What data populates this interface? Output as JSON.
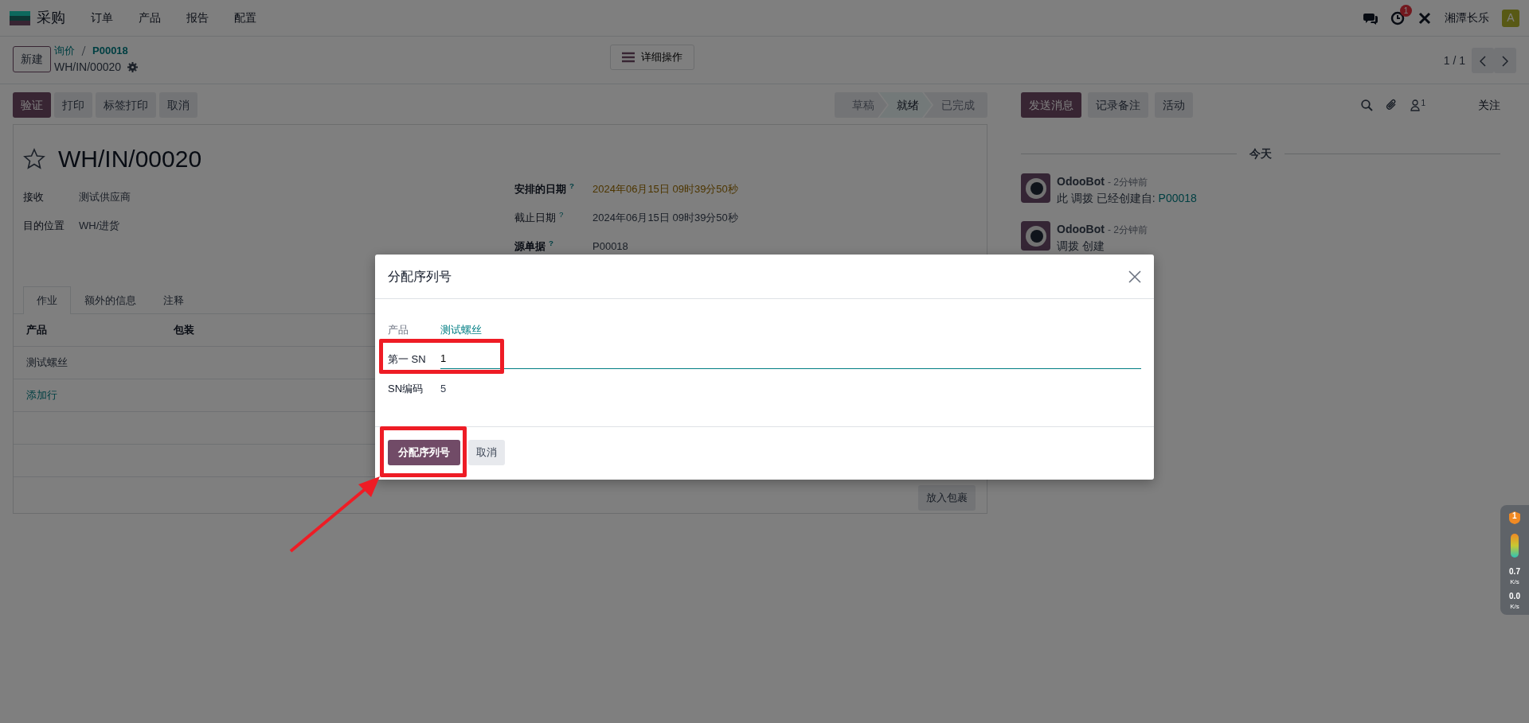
{
  "navbar": {
    "app": "采购",
    "menus": [
      "订单",
      "产品",
      "报告",
      "配置"
    ],
    "activity_count": "1",
    "company": "湘潭长乐",
    "avatar": "A"
  },
  "control_panel": {
    "new_button": "新建",
    "breadcrumbs": [
      "询价",
      "P00018"
    ],
    "record": "WH/IN/00020",
    "actions_button": "详细操作",
    "pager": "1 / 1"
  },
  "buttons": [
    {
      "label": "验证",
      "kind": "primary"
    },
    {
      "label": "打印",
      "kind": "secondary"
    },
    {
      "label": "标签打印",
      "kind": "secondary"
    },
    {
      "label": "取消",
      "kind": "secondary"
    }
  ],
  "status_steps": [
    {
      "label": "草稿",
      "selected": false
    },
    {
      "label": "就绪",
      "selected": true
    },
    {
      "label": "已完成",
      "selected": false
    }
  ],
  "sheet": {
    "starred": false,
    "title": "WH/IN/00020",
    "left_fields": [
      {
        "label": "接收",
        "value": "测试供应商"
      },
      {
        "label": "目的位置",
        "value": "WH/进货"
      }
    ],
    "right_fields": [
      {
        "label": "安排的日期",
        "help": "?",
        "value": "2024年06月15日 09时39分50秒",
        "bold": true,
        "kind": "warning"
      },
      {
        "label": "截止日期",
        "help": "?",
        "value": "2024年06月15日 09时39分50秒",
        "bold": false,
        "kind": "normal"
      },
      {
        "label": "源单据",
        "help": "?",
        "value": "P00018",
        "bold": true,
        "kind": "normal"
      }
    ],
    "tabs": [
      {
        "label": "作业",
        "selected": true
      },
      {
        "label": "额外的信息",
        "selected": false
      },
      {
        "label": "注释",
        "selected": false
      }
    ],
    "columns": [
      "产品",
      "包装"
    ],
    "rows": [
      [
        "测试螺丝"
      ]
    ],
    "add_line": "添加行",
    "put_in_pack": "放入包裹"
  },
  "chatter": {
    "buttons": [
      {
        "label": "发送消息",
        "kind": "primary"
      },
      {
        "label": "记录备注",
        "kind": "secondary"
      },
      {
        "label": "活动",
        "kind": "secondary"
      }
    ],
    "follower_count": "1",
    "follow": "关注",
    "date_separator": "今天",
    "messages": [
      {
        "author": "OdooBot",
        "time": "- 2分钟前",
        "body": "此 调拨 已经创建自: ",
        "link": "P00018"
      },
      {
        "author": "OdooBot",
        "time": "- 2分钟前",
        "body": "调拨 创建"
      }
    ]
  },
  "dialog": {
    "title": "分配序列号",
    "fields": [
      {
        "label": "产品",
        "value": "测试螺丝",
        "kind": "link"
      },
      {
        "label": "第一 SN",
        "value": "1",
        "kind": "input"
      },
      {
        "label": "SN编码",
        "value": "5",
        "kind": "text"
      }
    ],
    "buttons": [
      {
        "label": "分配序列号",
        "kind": "primary"
      },
      {
        "label": "取消",
        "kind": "secondary"
      }
    ]
  },
  "speed_widget": {
    "badge": "1",
    "up": "0.7",
    "up_unit": "K/s",
    "down": "0.0",
    "down_unit": "K/s"
  }
}
